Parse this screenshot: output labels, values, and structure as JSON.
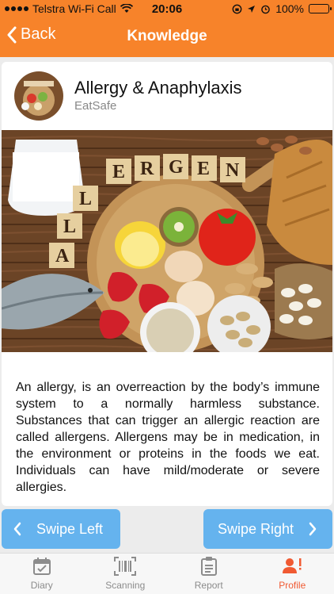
{
  "status_bar": {
    "carrier": "Telstra Wi-Fi Call",
    "time": "20:06",
    "battery": "100%"
  },
  "header": {
    "back_label": "Back",
    "title": "Knowledge"
  },
  "article": {
    "title": "Allergy & Anaphylaxis",
    "source": "EatSafe",
    "image_word": "ALLERGENS",
    "body": "An allergy, is an overreaction by the body’s immune system to a normally harmless substance. Substances that can trigger an allergic reaction are called allergens. Allergens may be in medication, in the environment or proteins in the foods we eat. Individuals can have mild/moderate or severe allergies."
  },
  "swipe": {
    "left_label": "Swipe Left",
    "right_label": "Swipe Right"
  },
  "tabs": [
    {
      "label": "Diary",
      "icon": "calendar-icon"
    },
    {
      "label": "Scanning",
      "icon": "barcode-icon"
    },
    {
      "label": "Report",
      "icon": "clipboard-icon"
    },
    {
      "label": "Profile",
      "icon": "profile-alert-icon",
      "active": true
    }
  ],
  "colors": {
    "header": "#f7832a",
    "swipe_button": "#65b3ee",
    "active_tab": "#f05a32"
  }
}
